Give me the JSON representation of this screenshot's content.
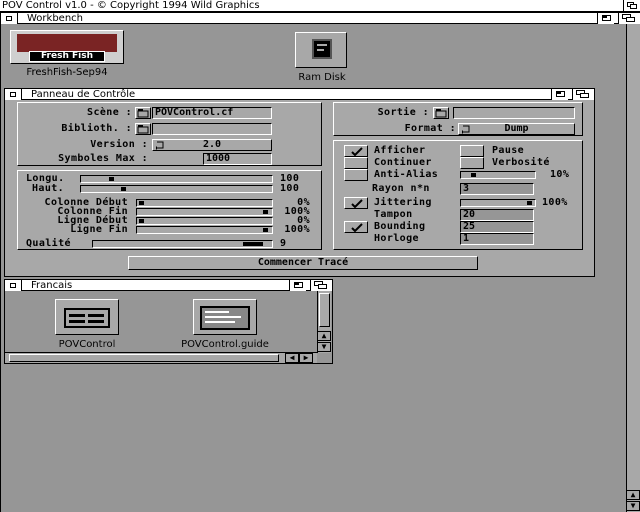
{
  "screen": {
    "title": "POV Control v1.0 - © Copyright 1994 Wild Graphics"
  },
  "workbench": {
    "title": "Workbench",
    "icons": [
      {
        "label": "FreshFish-Sep94",
        "badge": "Fresh Fish"
      },
      {
        "label": "Ram Disk"
      }
    ]
  },
  "panel": {
    "title": "Panneau de Contrôle",
    "scene": {
      "label": "Scène :",
      "value": "POVControl.cf"
    },
    "biblio": {
      "label": "Biblioth. :",
      "value": ""
    },
    "version": {
      "label": "Version :",
      "value": "2.0"
    },
    "symboles": {
      "label": "Symboles Max :",
      "value": "1000"
    },
    "sortie": {
      "label": "Sortie :",
      "value": ""
    },
    "format": {
      "label": "Format :",
      "value": "Dump"
    },
    "sliders": [
      {
        "label": "Longu.",
        "value": "100"
      },
      {
        "label": "Haut.",
        "value": "100"
      },
      {
        "label": "Colonne Début",
        "value": "0%"
      },
      {
        "label": "Colonne Fin",
        "value": "100%"
      },
      {
        "label": "Ligne Début",
        "value": "0%"
      },
      {
        "label": "Ligne Fin",
        "value": "100%"
      },
      {
        "label": "Qualité",
        "value": "9"
      }
    ],
    "options": {
      "afficher": {
        "label": "Afficher",
        "checked": true
      },
      "pause": {
        "label": "Pause",
        "checked": false
      },
      "continuer": {
        "label": "Continuer",
        "checked": false
      },
      "verbosite": {
        "label": "Verbosité",
        "checked": false
      },
      "antialias": {
        "label": "Anti-Alias",
        "checked": false,
        "value": "10%"
      },
      "rayon": {
        "label": "Rayon n*n",
        "value": "3"
      },
      "jittering": {
        "label": "Jittering",
        "checked": true,
        "value": "100%"
      },
      "tampon": {
        "label": "Tampon",
        "value": "20"
      },
      "bounding": {
        "label": "Bounding",
        "checked": true,
        "value": "25"
      },
      "horloge": {
        "label": "Horloge",
        "value": "1"
      }
    },
    "start_button": "Commencer  Tracé"
  },
  "francais": {
    "title": "Francais",
    "icons": [
      {
        "label": "POVControl"
      },
      {
        "label": "POVControl.guide"
      }
    ]
  }
}
